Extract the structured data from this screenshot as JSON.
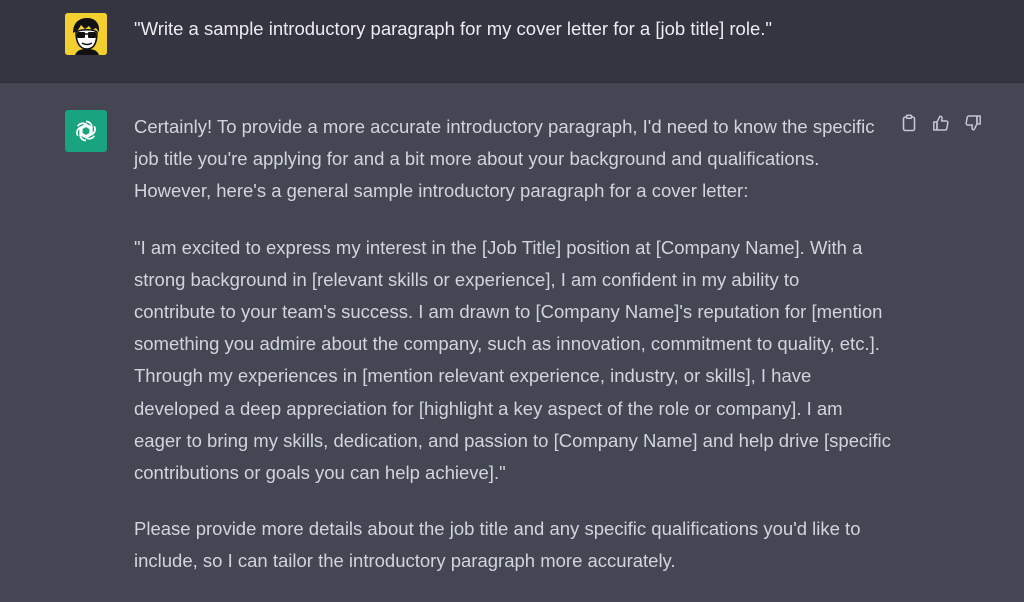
{
  "user_message": {
    "text": "\"Write a sample introductory paragraph for my cover letter for a [job title] role.\""
  },
  "assistant_message": {
    "paragraphs": [
      {
        "lines": [
          "Certainly! To provide a more accurate introductory paragraph, I'd need to know the specific",
          "job title you're applying for and a bit more about your background and qualifications.",
          "However, here's a general sample introductory paragraph for a cover letter:"
        ]
      },
      {
        "lines": [
          "\"I am excited to express my interest in the [Job Title] position at [Company Name]. With a",
          "strong background in [relevant skills or experience], I am confident in my ability to",
          "contribute to your team's success. I am drawn to [Company Name]'s reputation for [mention",
          "something you admire about the company, such as innovation, commitment to quality, etc.].",
          "Through my experiences in [mention relevant experience, industry, or skills], I have",
          "developed a deep appreciation for [highlight a key aspect of the role or company]. I am",
          "eager to bring my skills, dedication, and passion to [Company Name] and help drive [specific",
          "contributions or goals you can help achieve].\""
        ]
      },
      {
        "lines": [
          "Please provide more details about the job title and any specific qualifications you'd like to",
          "include, so I can tailor the introductory paragraph more accurately."
        ]
      }
    ]
  },
  "actions": {
    "icons": [
      "clipboard-icon",
      "thumbs-up-icon",
      "thumbs-down-icon"
    ]
  },
  "colors": {
    "user_bg": "#343541",
    "assistant_bg": "#444654",
    "text": "#d1d5db",
    "user_avatar_bg": "#f4cf30",
    "gpt_avatar_bg": "#19a37f"
  }
}
